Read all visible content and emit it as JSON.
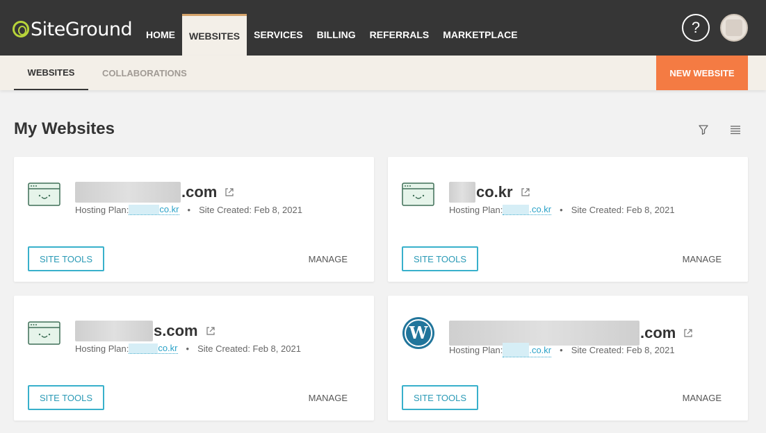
{
  "brand": {
    "name": "SiteGround",
    "accent": "#f47b43",
    "logo_green": "#b8d43a"
  },
  "nav": [
    {
      "label": "Home"
    },
    {
      "label": "Websites"
    },
    {
      "label": "Services"
    },
    {
      "label": "Billing"
    },
    {
      "label": "Referrals"
    },
    {
      "label": "Marketplace"
    }
  ],
  "header": {
    "help": "?"
  },
  "subnav": {
    "websites": "Websites",
    "collaborations": "Collaborations",
    "new_website": "New Website"
  },
  "page": {
    "title": "My Websites",
    "filter_icon": "filter-icon",
    "list_icon": "list-view-icon"
  },
  "sites": [
    {
      "name_suffix": ".com",
      "plan_label": "Hosting Plan:",
      "plan_suffix": "co.kr",
      "separator": "•",
      "created": "Site Created: Feb 8, 2021",
      "icon": "site-window-icon",
      "site_tools": "Site Tools",
      "manage": "Manage"
    },
    {
      "name_suffix": "co.kr",
      "plan_label": "Hosting Plan:",
      "plan_suffix": ".co.kr",
      "separator": "•",
      "created": "Site Created: Feb 8, 2021",
      "icon": "site-window-icon",
      "site_tools": "Site Tools",
      "manage": "Manage"
    },
    {
      "name_suffix": "s.com",
      "plan_label": "Hosting Plan:",
      "plan_suffix": "co.kr",
      "separator": "•",
      "created": "Site Created: Feb 8, 2021",
      "icon": "site-window-icon",
      "site_tools": "Site Tools",
      "manage": "Manage"
    },
    {
      "name_suffix": ".com",
      "plan_label": "Hosting Plan:",
      "plan_suffix": ".co.kr",
      "separator": "•",
      "created": "Site Created: Feb 8, 2021",
      "icon": "wordpress-icon",
      "site_tools": "Site Tools",
      "manage": "Manage"
    }
  ]
}
